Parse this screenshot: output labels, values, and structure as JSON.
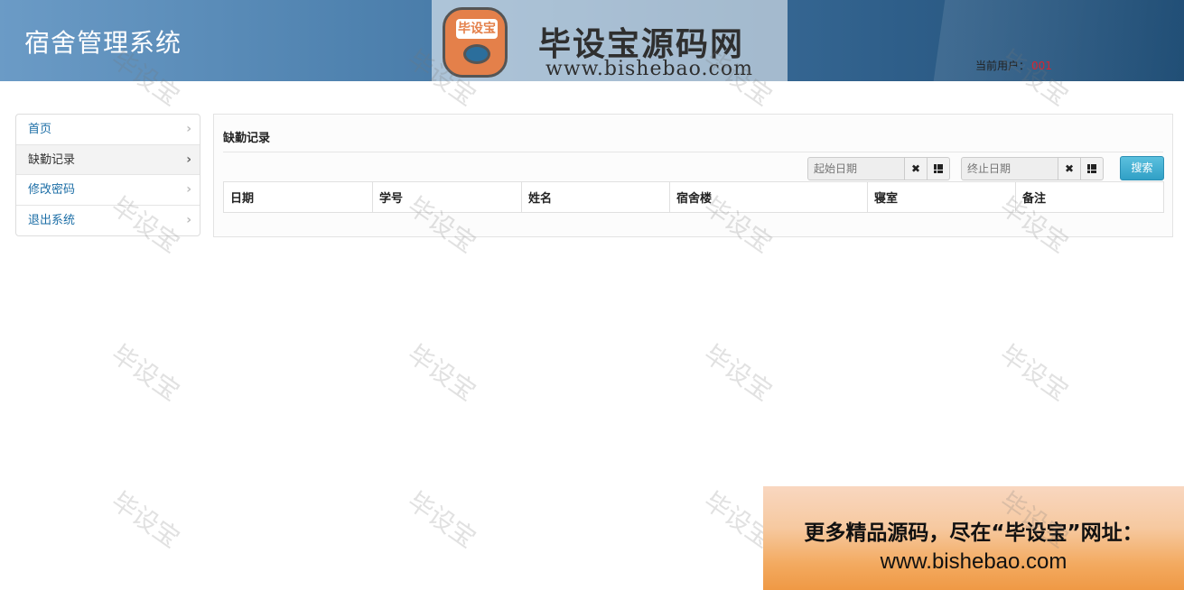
{
  "header": {
    "title": "宿舍管理系统",
    "user_label": "当前用户：",
    "user_name": "001"
  },
  "logo_banner": {
    "icon_label": "毕设宝",
    "name": "毕设宝源码网",
    "url": "www.bishebao.com"
  },
  "sidebar": {
    "items": [
      {
        "label": "首页",
        "active": false
      },
      {
        "label": "缺勤记录",
        "active": true
      },
      {
        "label": "修改密码",
        "active": false
      },
      {
        "label": "退出系统",
        "active": false
      }
    ],
    "chevron": "›"
  },
  "main": {
    "title": "缺勤记录",
    "start_date_placeholder": "起始日期",
    "end_date_placeholder": "终止日期",
    "clear_symbol": "✖",
    "search_label": "搜索",
    "table": {
      "columns": [
        "日期",
        "学号",
        "姓名",
        "宿舍楼",
        "寝室",
        "备注"
      ],
      "rows": []
    }
  },
  "watermark_text": "毕设宝",
  "ad": {
    "line1": "更多精品源码，尽在“毕设宝”网址：",
    "line2": "www.bishebao.com"
  },
  "colors": {
    "header_start": "#6b9bc6",
    "header_end": "#1f4d75",
    "link": "#1c6ea6",
    "user_name": "#d9232e",
    "search_button": "#31a0c6"
  }
}
